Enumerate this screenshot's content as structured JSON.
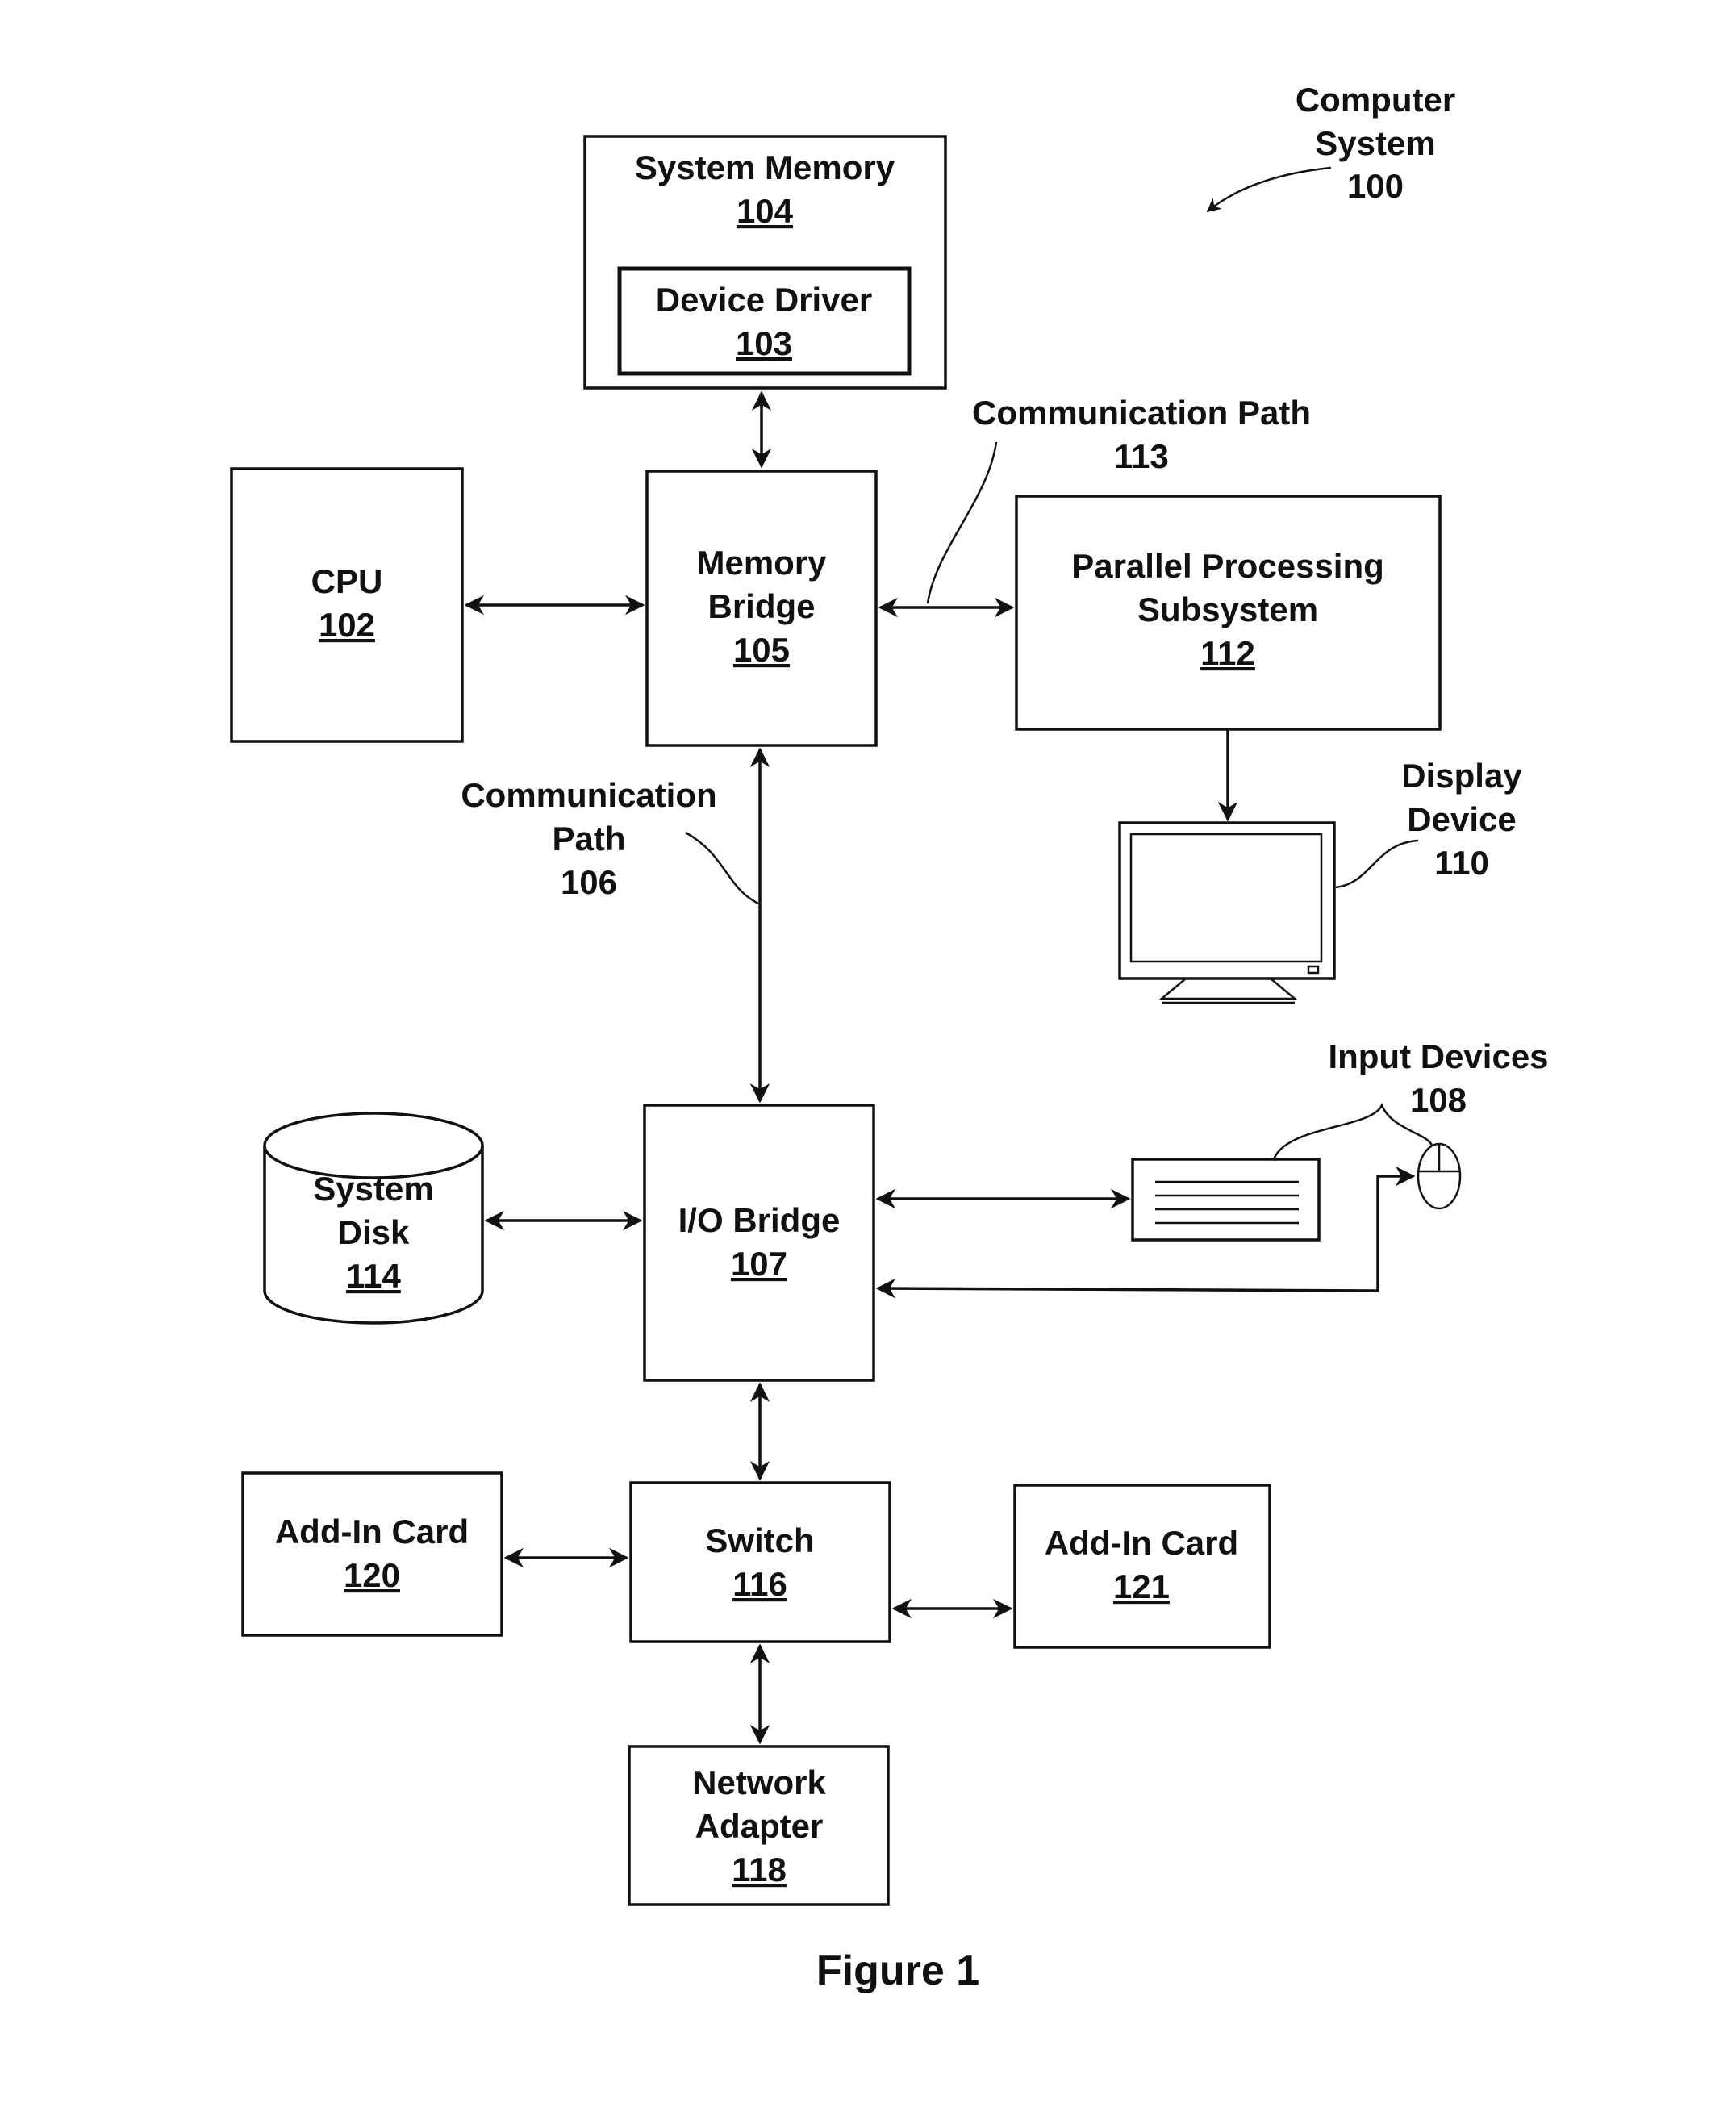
{
  "title": {
    "line1": "Computer",
    "line2": "System",
    "ref": "100"
  },
  "figure_caption": "Figure 1",
  "blocks": {
    "system_memory": {
      "label": "System Memory",
      "ref": "104"
    },
    "device_driver": {
      "label": "Device Driver",
      "ref": "103"
    },
    "cpu": {
      "label": "CPU",
      "ref": "102"
    },
    "memory_bridge": {
      "line1": "Memory",
      "line2": "Bridge",
      "ref": "105"
    },
    "parallel_processing": {
      "line1": "Parallel Processing",
      "line2": "Subsystem",
      "ref": "112"
    },
    "display_device": {
      "line1": "Display",
      "line2": "Device",
      "ref": "110"
    },
    "io_bridge": {
      "label": "I/O Bridge",
      "ref": "107"
    },
    "system_disk": {
      "line1": "System",
      "line2": "Disk",
      "ref": "114"
    },
    "input_devices": {
      "label": "Input Devices",
      "ref": "108"
    },
    "add_in_card_120": {
      "label": "Add-In Card",
      "ref": "120"
    },
    "switch": {
      "label": "Switch",
      "ref": "116"
    },
    "add_in_card_121": {
      "label": "Add-In Card",
      "ref": "121"
    },
    "network_adapter": {
      "line1": "Network",
      "line2": "Adapter",
      "ref": "118"
    }
  },
  "paths": {
    "comm_path_113": {
      "label": "Communication Path",
      "ref": "113"
    },
    "comm_path_106": {
      "line1": "Communication",
      "line2": "Path",
      "ref": "106"
    }
  }
}
